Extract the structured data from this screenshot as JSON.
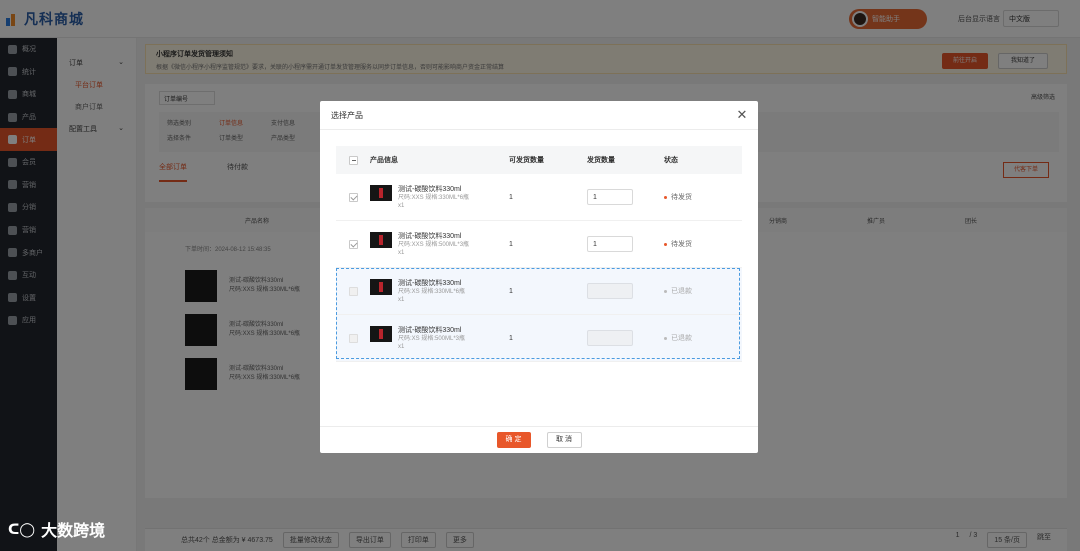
{
  "app": {
    "logo_text": "凡科商城",
    "support_label": "智能助手",
    "lang_label": "后台显示语言",
    "lang_value": "中文版"
  },
  "sidebar": {
    "items": [
      {
        "label": "概况"
      },
      {
        "label": "统计"
      },
      {
        "label": "商城"
      },
      {
        "label": "产品"
      },
      {
        "label": "订单"
      },
      {
        "label": "会员"
      },
      {
        "label": "营销"
      },
      {
        "label": "分销"
      },
      {
        "label": "营销"
      },
      {
        "label": "多商户"
      },
      {
        "label": "互动"
      },
      {
        "label": "设置"
      },
      {
        "label": "应用"
      }
    ]
  },
  "subnav": {
    "group1": "订单",
    "sub1": "平台订单",
    "sub2": "商户订单",
    "group2": "配置工具"
  },
  "notice": {
    "title": "小程序订单发货管理须知",
    "body": "根据《微信小程序小程序监管规范》要求，关联的小程序需开通订单发货管理服务以同步订单信息，否则可能影响商户资金正常结算",
    "btn_go": "前往开启",
    "btn_know": "我知道了"
  },
  "filters": {
    "select": "订单编号",
    "advanced": "高级筛选",
    "row1_label": "筛选类别",
    "row1_a": "订单信息",
    "row1_b": "支付信息",
    "row2_label": "选择条件",
    "row2_a": "订单类型",
    "row2_b": "产品类型"
  },
  "tabs": [
    "全部订单",
    "待付款"
  ],
  "proxy_button": "代客下单",
  "table": {
    "headers": [
      "产品名称",
      "分销商",
      "推广员",
      "团长"
    ],
    "order_row": "下单时间：2024-08-12 15:48:35",
    "product_name": "测试-碳酸饮料330ml",
    "product_spec": "尺码:XXS 规格:330ML*6瓶"
  },
  "bottom_bar": {
    "summary": "总共42个  总金额为 ¥ 4673.75",
    "batch": "批量修改状态",
    "export": "导出订单",
    "print": "打印单",
    "more": "更多",
    "page": "1",
    "total_pages": "/ 3",
    "per_page": "15 条/页",
    "jump": "跳至"
  },
  "watermark": "大数跨境",
  "modal": {
    "title": "选择产品",
    "headers": {
      "info": "产品信息",
      "qty": "可发货数量",
      "send": "发货数量",
      "status": "状态"
    },
    "rows": [
      {
        "name": "测试-碳酸饮料330ml",
        "spec": "尺码:XXS 规格:330ML*6瓶",
        "count": "x1",
        "qty": "1",
        "send": "1",
        "status": "待发货",
        "checked": true,
        "disabled": false
      },
      {
        "name": "测试-碳酸饮料330ml",
        "spec": "尺码:XXS 规格:500ML*3瓶",
        "count": "x1",
        "qty": "1",
        "send": "1",
        "status": "待发货",
        "checked": true,
        "disabled": false
      },
      {
        "name": "测试-碳酸饮料330ml",
        "spec": "尺码:XS 规格:330ML*6瓶",
        "count": "x1",
        "qty": "1",
        "send": "",
        "status": "已退款",
        "checked": false,
        "disabled": true
      },
      {
        "name": "测试-碳酸饮料330ml",
        "spec": "尺码:XS 规格:500ML*3瓶",
        "count": "x1",
        "qty": "1",
        "send": "",
        "status": "已退款",
        "checked": false,
        "disabled": true
      }
    ],
    "ok_label": "确 定",
    "cancel_label": "取 消"
  },
  "colors": {
    "accent": "#e8572a",
    "sidebar": "#23272e",
    "highlight": "#4b9be0"
  }
}
